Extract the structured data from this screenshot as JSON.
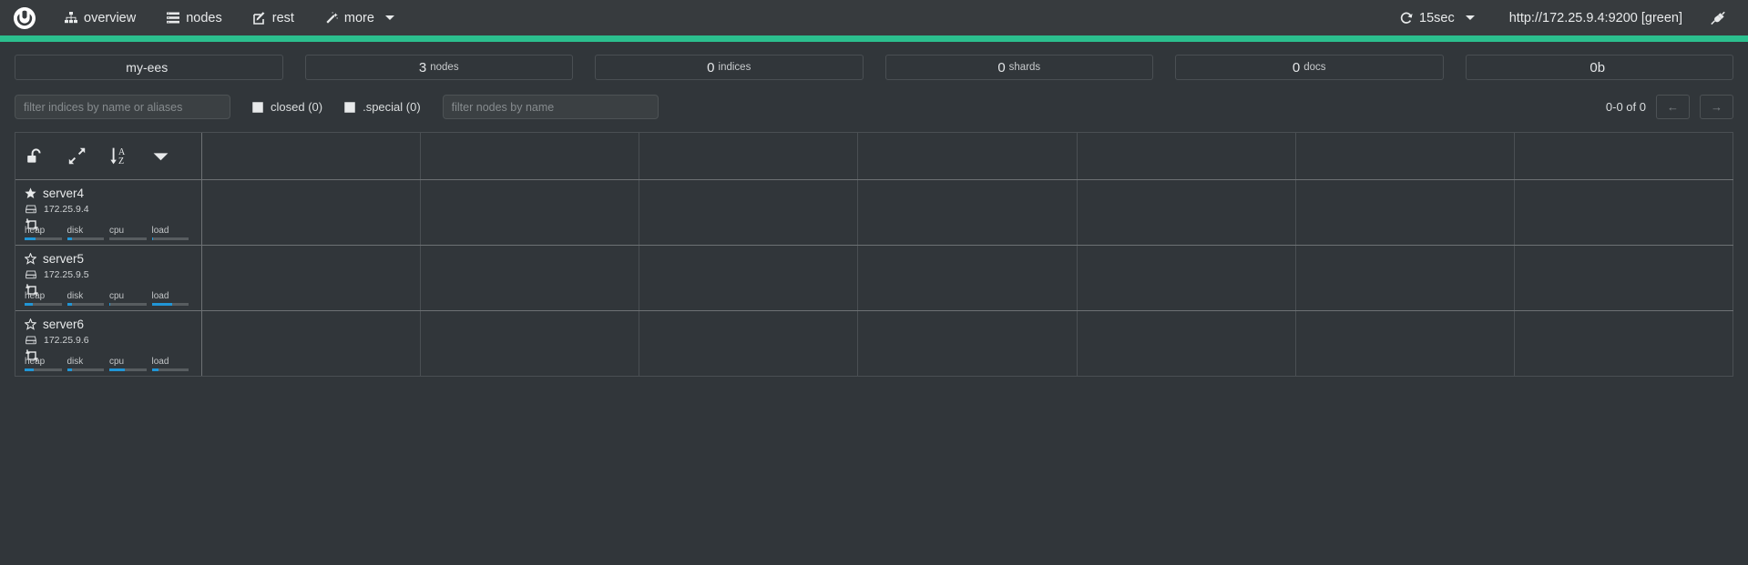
{
  "navbar": {
    "brand_icon": "cerebro-logo-icon",
    "items": [
      {
        "label": "overview",
        "icon": "sitemap-icon"
      },
      {
        "label": "nodes",
        "icon": "server-list-icon"
      },
      {
        "label": "rest",
        "icon": "edit-square-icon"
      },
      {
        "label": "more",
        "icon": "magic-wand-icon",
        "has_caret": true
      }
    ],
    "refresh": {
      "label": "15sec",
      "icon": "refresh-icon",
      "has_caret": true
    },
    "cluster_url": "http://172.25.9.4:9200 [green]",
    "disconnect_icon": "plug-icon",
    "accent_color": "#2bbf8e"
  },
  "stats": [
    {
      "name": "cluster-name",
      "value": "my-ees",
      "label": ""
    },
    {
      "name": "nodes-count",
      "value": "3",
      "label": "nodes"
    },
    {
      "name": "indices-count",
      "value": "0",
      "label": "indices"
    },
    {
      "name": "shards-count",
      "value": "0",
      "label": "shards"
    },
    {
      "name": "docs-count",
      "value": "0",
      "label": "docs"
    },
    {
      "name": "store-size",
      "value": "0b",
      "label": ""
    }
  ],
  "filters": {
    "indices_placeholder": "filter indices by name or aliases",
    "indices_value": "",
    "closed_label": "closed (0)",
    "special_label": ".special (0)",
    "nodes_placeholder": "filter nodes by name",
    "nodes_value": "",
    "pager_count": "0-0 of 0",
    "prev_label": "←",
    "next_label": "→"
  },
  "toolbar": {
    "lock_icon": "unlock-icon",
    "expand_icon": "expand-arrows-icon",
    "sort_icon": "sort-alpha-asc-icon",
    "menu_icon": "caret-down-icon"
  },
  "nodes": [
    {
      "name": "server4",
      "ip": "172.25.9.4",
      "master": true,
      "star_icon": "star-filled-icon",
      "ip_icon": "hdd-icon",
      "role_icon": "data-node-icon",
      "metrics": [
        {
          "label": "heap",
          "percent": 30
        },
        {
          "label": "disk",
          "percent": 14
        },
        {
          "label": "cpu",
          "percent": 0
        },
        {
          "label": "load",
          "percent": 3
        }
      ]
    },
    {
      "name": "server5",
      "ip": "172.25.9.5",
      "master": false,
      "star_icon": "star-outline-icon",
      "ip_icon": "hdd-icon",
      "role_icon": "data-node-icon",
      "metrics": [
        {
          "label": "heap",
          "percent": 22
        },
        {
          "label": "disk",
          "percent": 14
        },
        {
          "label": "cpu",
          "percent": 3
        },
        {
          "label": "load",
          "percent": 55
        }
      ]
    },
    {
      "name": "server6",
      "ip": "172.25.9.6",
      "master": false,
      "star_icon": "star-outline-icon",
      "ip_icon": "hdd-icon",
      "role_icon": "data-node-icon",
      "metrics": [
        {
          "label": "heap",
          "percent": 25
        },
        {
          "label": "disk",
          "percent": 14
        },
        {
          "label": "cpu",
          "percent": 42
        },
        {
          "label": "load",
          "percent": 18
        }
      ]
    }
  ],
  "grid": {
    "index_columns": 7
  }
}
